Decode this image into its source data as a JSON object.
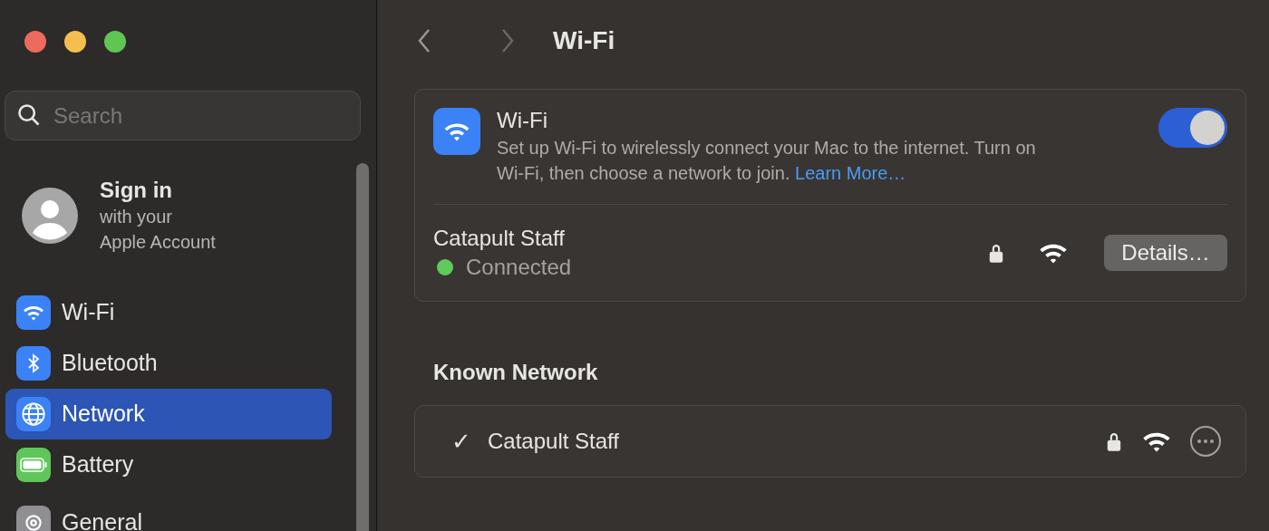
{
  "window": {
    "title": "Wi-Fi"
  },
  "sidebar": {
    "search": {
      "placeholder": "Search"
    },
    "account": {
      "title": "Sign in",
      "subtitle": "with your",
      "subtitle_2": "Apple Account"
    },
    "items": [
      {
        "label": "Wi-Fi",
        "kind": "wifi",
        "selected": false
      },
      {
        "label": "Bluetooth",
        "kind": "bluetooth",
        "selected": false
      },
      {
        "label": "Network",
        "kind": "network",
        "selected": true
      },
      {
        "label": "Battery",
        "kind": "battery",
        "selected": false
      },
      {
        "label": "General",
        "kind": "general",
        "selected": false
      }
    ]
  },
  "wifi_card": {
    "title": "Wi-Fi",
    "description": "Set up Wi-Fi to wirelessly connect your Mac to the internet. Turn on Wi-Fi, then choose a network to join.",
    "link": "Learn More…",
    "on": true,
    "network": {
      "name": "Catapult Staff",
      "status": "Connected",
      "color": "#5ecb5a",
      "button": "Details…"
    }
  },
  "known": {
    "heading": "Known Network",
    "items": [
      {
        "name": "Catapult Staff",
        "checked": true,
        "check": "✓"
      }
    ]
  }
}
